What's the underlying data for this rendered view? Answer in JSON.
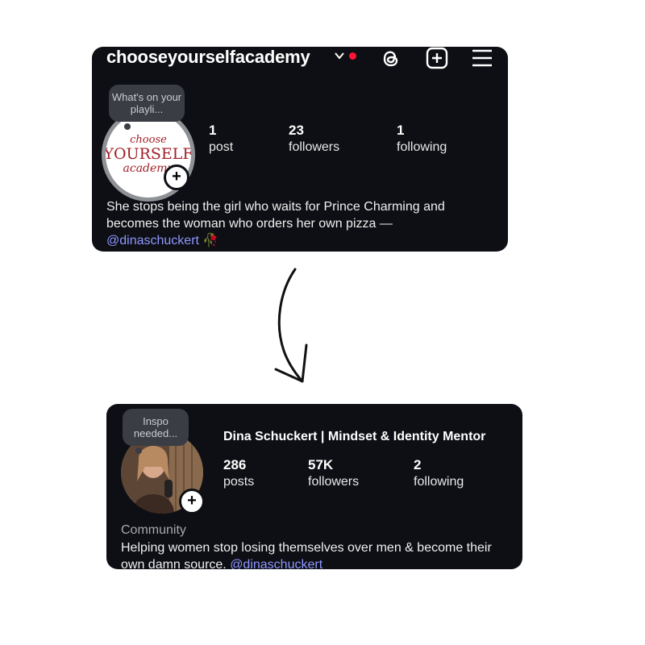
{
  "profile_before": {
    "username": "chooseyourselfacademy",
    "note_bubble": "What's on your playli...",
    "logo": {
      "line1": "choose",
      "line2": "YOURSELF",
      "line3": "academy",
      "color": "#a02028"
    },
    "stats": [
      {
        "value": "1",
        "label": "post"
      },
      {
        "value": "23",
        "label": "followers"
      },
      {
        "value": "1",
        "label": "following"
      }
    ],
    "bio_text": "She stops being the girl who waits for Prince Charming and becomes the woman who orders her own pizza —",
    "bio_mention": "@dinaschuckert",
    "bio_emoji": "🥀",
    "icons": [
      "chevron-down-icon",
      "threads-icon",
      "new-post-icon",
      "menu-icon"
    ],
    "notification_color": "#ff1436"
  },
  "profile_after": {
    "note_bubble": "Inspo needed...",
    "full_name": "Dina Schuckert | Mindset & Identity Mentor",
    "stats": [
      {
        "value": "286",
        "label": "posts"
      },
      {
        "value": "57K",
        "label": "followers"
      },
      {
        "value": "2",
        "label": "following"
      }
    ],
    "category": "Community",
    "bio_text": "Helping women stop losing themselves over men & become their own damn source.",
    "bio_mention": "@dinaschuckert"
  },
  "colors": {
    "card_bg": "#0d0f14",
    "mention": "#8f96ff",
    "arrow": "#111111"
  }
}
